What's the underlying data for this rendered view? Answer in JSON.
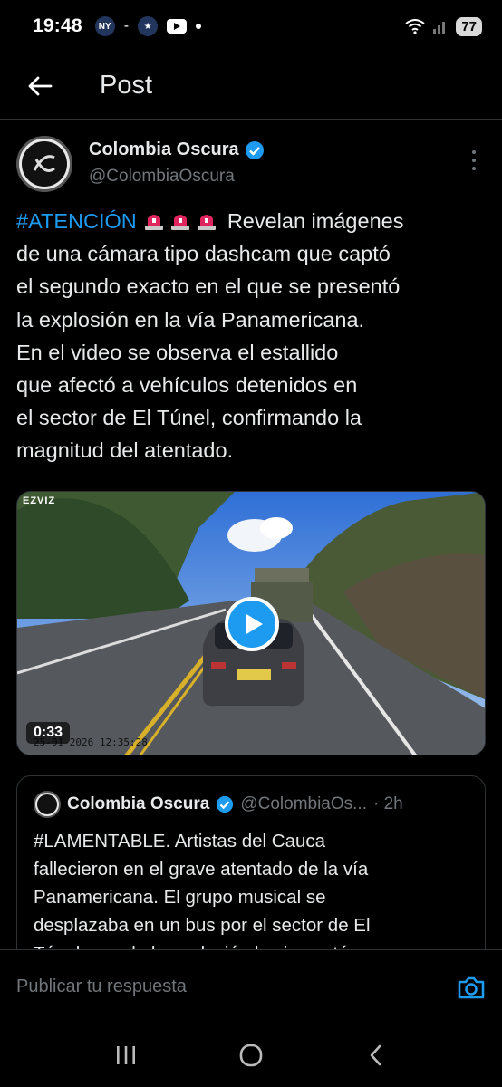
{
  "status_bar": {
    "time": "19:48",
    "battery": "77",
    "icons": [
      "yankees-icon",
      "astros-icon",
      "youtube-icon",
      "wifi-icon",
      "signal-icon"
    ]
  },
  "header": {
    "title": "Post"
  },
  "post": {
    "author_name": "Colombia Oscura",
    "author_handle": "@ColombiaOscura",
    "text_lines": [
      {
        "hashtag": "#ATENCIÓN",
        "rest": "Revelan imágenes"
      },
      "de una cámara tipo dashcam que captó",
      "el segundo exacto en el que se presentó",
      "la explosión en la vía Panamericana.",
      "En el video se observa el estallido",
      "que afectó a vehículos detenidos en",
      "el sector de El Túnel, confirmando la",
      "magnitud del atentado."
    ],
    "video": {
      "duration": "0:33",
      "watermark": "EZVIZ",
      "timestamp": "25-01-2026 12:35:28"
    }
  },
  "quote": {
    "author_name": "Colombia Oscura",
    "author_handle": "@ColombiaOs...",
    "time": "· 2h",
    "text_lines": [
      "#LAMENTABLE. Artistas del Cauca",
      "fallecieron en el grave atentado de la vía",
      "Panamericana. El grupo musical se",
      "desplazaba en un bus por el sector de El",
      "Túnel cuando la explosión los impactó."
    ]
  },
  "reply": {
    "placeholder": "Publicar tu respuesta"
  },
  "colors": {
    "accent": "#1d9bf0",
    "background": "#000000",
    "muted": "#71767b",
    "siren": "#e0245e"
  }
}
